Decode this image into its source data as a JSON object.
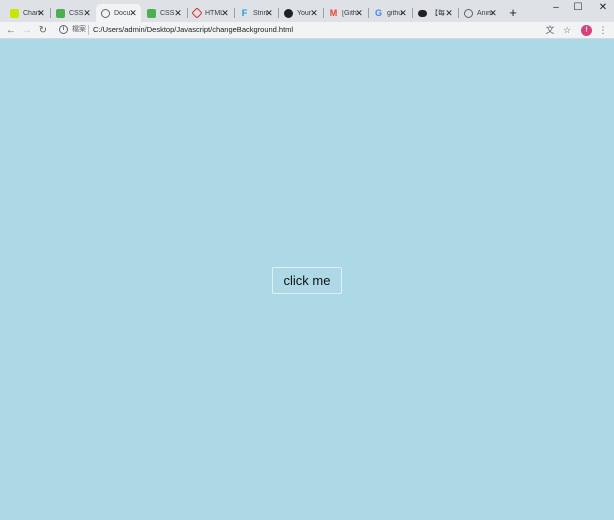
{
  "tabs": [
    {
      "title": "Chan",
      "icon": "youtube-music-icon",
      "color": "#c8e600",
      "active": false
    },
    {
      "title": "CSS",
      "icon": "w3schools-icon",
      "color": "#4caf50",
      "active": false
    },
    {
      "title": "Docu",
      "icon": "globe-icon",
      "color": "#5f6368",
      "active": true
    },
    {
      "title": "CSS",
      "icon": "w3schools-icon",
      "color": "#4caf50",
      "active": false
    },
    {
      "title": "HTML",
      "icon": "htmlpen-icon",
      "color": "#d93025",
      "active": false
    },
    {
      "title": "Strin",
      "icon": "f-logo-icon",
      "color": "#1a9bd7",
      "active": false
    },
    {
      "title": "Your",
      "icon": "github-icon",
      "color": "#202124",
      "active": false
    },
    {
      "title": "[Gith",
      "icon": "gmail-icon",
      "color": "#ea4335",
      "active": false
    },
    {
      "title": "githu",
      "icon": "google-icon",
      "color": "#4285f4",
      "active": false
    },
    {
      "title": "【每",
      "icon": "cloud-icon",
      "color": "#202124",
      "active": false
    },
    {
      "title": "Anim",
      "icon": "globe-icon",
      "color": "#5f6368",
      "active": false
    }
  ],
  "toolbar": {
    "file_label": "檔案",
    "url": "C:/Users/admin/Desktop/Javascript/changeBackground.html",
    "avatar_letter": "f"
  },
  "page": {
    "background": "#add8e6",
    "button_label": "click me"
  }
}
